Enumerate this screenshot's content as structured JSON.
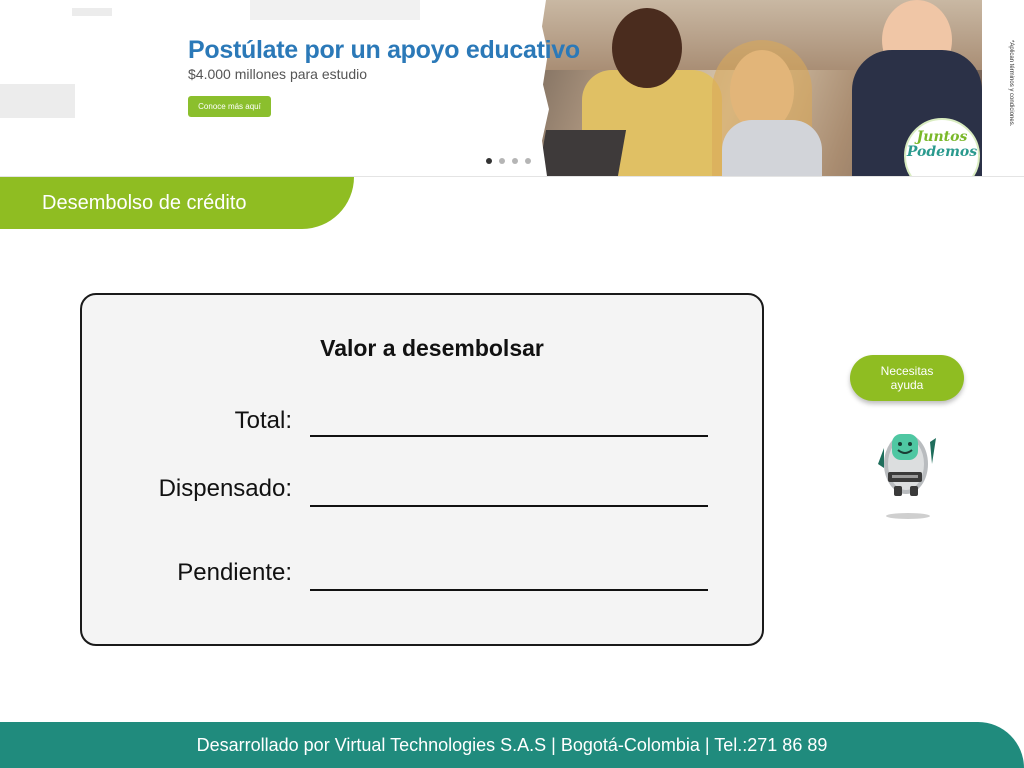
{
  "banner": {
    "title": "Postúlate por un apoyo educativo",
    "subtitle": "$4.000 millones para estudio",
    "button_label": "Conoce más aquí",
    "logo_line1": "Juntos",
    "logo_line2": "Podemos",
    "terms_note": "*Aplican términos y condiciones.",
    "carousel_dots": 4,
    "active_dot": 1
  },
  "section": {
    "title": "Desembolso de crédito"
  },
  "card": {
    "title": "Valor a desembolsar",
    "rows": [
      {
        "label": "Total:",
        "value": ""
      },
      {
        "label": "Dispensado:",
        "value": ""
      },
      {
        "label": "Pendiente:",
        "value": ""
      }
    ]
  },
  "help": {
    "button_label_line1": "Necesitas",
    "button_label_line2": "ayuda",
    "robot_icon": "robot-assistant-icon"
  },
  "footer": {
    "text": "Desarrollado por Virtual Technologies S.A.S  |  Bogotá-Colombia  |  Tel.:271 86 89"
  },
  "colors": {
    "brand_green": "#8fbd22",
    "footer_teal": "#208b7d",
    "banner_blue": "#2b79b8"
  }
}
